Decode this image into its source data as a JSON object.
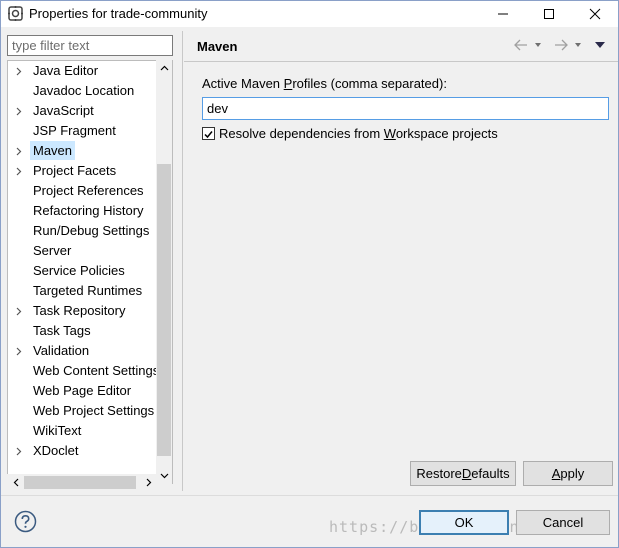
{
  "window": {
    "title": "Properties for trade-community"
  },
  "filter": {
    "placeholder": "type filter text"
  },
  "tree": {
    "items": [
      {
        "label": "Java Editor",
        "expandable": true
      },
      {
        "label": "Javadoc Location",
        "expandable": false
      },
      {
        "label": "JavaScript",
        "expandable": true
      },
      {
        "label": "JSP Fragment",
        "expandable": false
      },
      {
        "label": "Maven",
        "expandable": true,
        "selected": true
      },
      {
        "label": "Project Facets",
        "expandable": true
      },
      {
        "label": "Project References",
        "expandable": false
      },
      {
        "label": "Refactoring History",
        "expandable": false
      },
      {
        "label": "Run/Debug Settings",
        "expandable": false
      },
      {
        "label": "Server",
        "expandable": false
      },
      {
        "label": "Service Policies",
        "expandable": false
      },
      {
        "label": "Targeted Runtimes",
        "expandable": false
      },
      {
        "label": "Task Repository",
        "expandable": true
      },
      {
        "label": "Task Tags",
        "expandable": false
      },
      {
        "label": "Validation",
        "expandable": true
      },
      {
        "label": "Web Content Settings",
        "expandable": false
      },
      {
        "label": "Web Page Editor",
        "expandable": false
      },
      {
        "label": "Web Project Settings",
        "expandable": false
      },
      {
        "label": "WikiText",
        "expandable": false
      },
      {
        "label": "XDoclet",
        "expandable": true
      }
    ]
  },
  "page": {
    "title": "Maven",
    "profiles_label_pre": "Active Maven ",
    "profiles_label_mn": "P",
    "profiles_label_post": "rofiles (comma separated):",
    "profiles_value": "dev",
    "resolve_checked": true,
    "resolve_label_pre": "Resolve dependencies from ",
    "resolve_label_mn": "W",
    "resolve_label_post": "orkspace projects"
  },
  "buttons": {
    "restore_pre": "Restore ",
    "restore_mn": "D",
    "restore_post": "efaults",
    "apply_mn": "A",
    "apply_post": "pply",
    "ok": "OK",
    "cancel": "Cancel"
  },
  "watermark": "https://blog.csdn.net/lulro",
  "colors": {
    "selection": "#cce8ff",
    "focus_border": "#569de5",
    "default_button_border": "#3c7fb1"
  }
}
